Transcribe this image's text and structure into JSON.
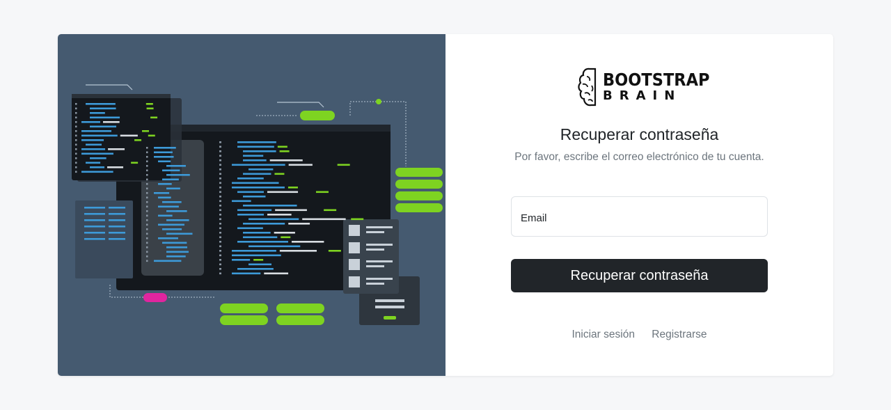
{
  "logo": {
    "line1": "BOOTSTRAP",
    "line2": "BRAIN",
    "icon": "brain-icon"
  },
  "form": {
    "title": "Recuperar contraseña",
    "subtitle": "Por favor, escribe el correo electrónico de tu cuenta.",
    "email_label": "Email",
    "email_value": "",
    "submit_label": "Recuperar contraseña"
  },
  "links": {
    "login": "Iniciar sesión",
    "register": "Registrarse"
  },
  "colors": {
    "page_bg": "#f6f7f9",
    "illustration_bg": "#455a70",
    "button_bg": "#212529",
    "accent_green": "#7ed321",
    "accent_blue": "#3d9ad8",
    "accent_magenta": "#e0259f"
  }
}
